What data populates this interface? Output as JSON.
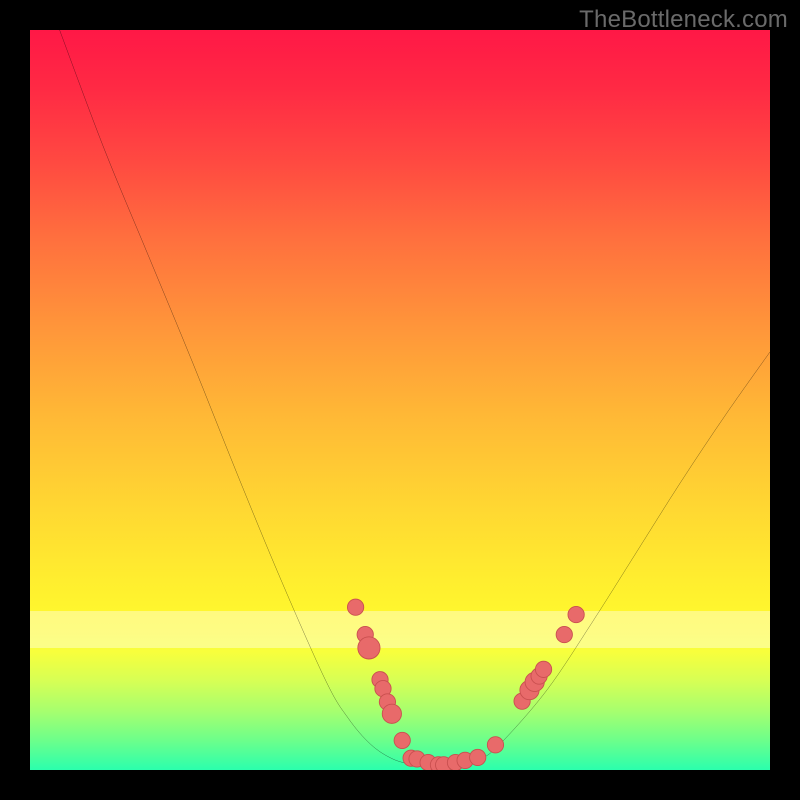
{
  "watermark": "TheBottleneck.com",
  "colors": {
    "frame": "#000000",
    "curve_stroke": "#000000",
    "marker_fill": "#e86a6a",
    "marker_stroke": "#c94f4f",
    "gradient_top": "#ff1846",
    "gradient_bottom": "#2bffad",
    "pale_band": "rgba(255,255,255,0.40)"
  },
  "chart_data": {
    "type": "line",
    "title": "",
    "xlabel": "",
    "ylabel": "",
    "xlim": [
      0,
      100
    ],
    "ylim": [
      0,
      100
    ],
    "grid": false,
    "legend": false,
    "annotations": [
      "TheBottleneck.com"
    ],
    "series": [
      {
        "name": "curve",
        "x": [
          4,
          10,
          16,
          22,
          28,
          34,
          40,
          43,
          46,
          49,
          52,
          55,
          58,
          61,
          64,
          70,
          76,
          82,
          88,
          94,
          100
        ],
        "y": [
          100,
          84,
          69.5,
          55,
          40,
          25.5,
          12,
          7,
          3.5,
          1.5,
          0.7,
          0.5,
          0.7,
          1.5,
          4,
          11,
          20,
          29.5,
          39,
          48,
          56.5
        ]
      }
    ],
    "markers": [
      {
        "id": 0,
        "x": 44.0,
        "y": 22.0,
        "r": 1.1
      },
      {
        "id": 1,
        "x": 45.3,
        "y": 18.3,
        "r": 1.1
      },
      {
        "id": 2,
        "x": 45.8,
        "y": 16.5,
        "r": 1.5
      },
      {
        "id": 3,
        "x": 47.3,
        "y": 12.2,
        "r": 1.1
      },
      {
        "id": 4,
        "x": 47.7,
        "y": 11.0,
        "r": 1.1
      },
      {
        "id": 5,
        "x": 48.3,
        "y": 9.2,
        "r": 1.1
      },
      {
        "id": 6,
        "x": 48.9,
        "y": 7.6,
        "r": 1.3
      },
      {
        "id": 7,
        "x": 50.3,
        "y": 4.0,
        "r": 1.1
      },
      {
        "id": 8,
        "x": 51.5,
        "y": 1.6,
        "r": 1.1
      },
      {
        "id": 9,
        "x": 52.3,
        "y": 1.5,
        "r": 1.1
      },
      {
        "id": 10,
        "x": 53.8,
        "y": 1.0,
        "r": 1.1
      },
      {
        "id": 11,
        "x": 55.2,
        "y": 0.7,
        "r": 1.1
      },
      {
        "id": 12,
        "x": 55.9,
        "y": 0.7,
        "r": 1.1
      },
      {
        "id": 13,
        "x": 57.5,
        "y": 1.0,
        "r": 1.1
      },
      {
        "id": 14,
        "x": 58.8,
        "y": 1.3,
        "r": 1.1
      },
      {
        "id": 15,
        "x": 60.5,
        "y": 1.7,
        "r": 1.1
      },
      {
        "id": 16,
        "x": 62.9,
        "y": 3.4,
        "r": 1.1
      },
      {
        "id": 17,
        "x": 66.5,
        "y": 9.3,
        "r": 1.1
      },
      {
        "id": 18,
        "x": 67.5,
        "y": 10.8,
        "r": 1.3
      },
      {
        "id": 19,
        "x": 68.2,
        "y": 11.9,
        "r": 1.3
      },
      {
        "id": 20,
        "x": 68.8,
        "y": 12.7,
        "r": 1.1
      },
      {
        "id": 21,
        "x": 69.4,
        "y": 13.6,
        "r": 1.1
      },
      {
        "id": 22,
        "x": 72.2,
        "y": 18.3,
        "r": 1.1
      },
      {
        "id": 23,
        "x": 73.8,
        "y": 21.0,
        "r": 1.1
      }
    ]
  }
}
